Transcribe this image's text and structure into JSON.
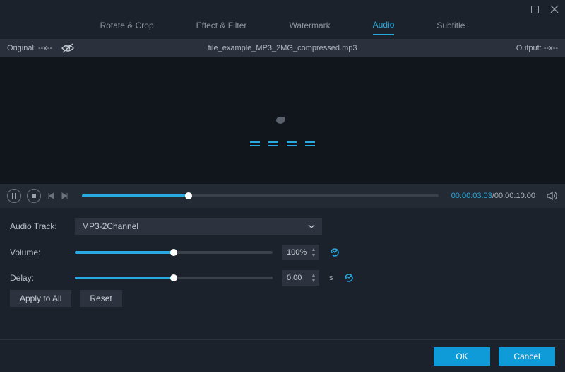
{
  "tabs": {
    "rotate": "Rotate & Crop",
    "effect": "Effect & Filter",
    "watermark": "Watermark",
    "audio": "Audio",
    "subtitle": "Subtitle"
  },
  "infobar": {
    "original_label": "Original: --x--",
    "filename": "file_example_MP3_2MG_compressed.mp3",
    "output_label": "Output: --x--"
  },
  "transport": {
    "current_time": "00:00:03.03",
    "total_time": "00:00:10.00",
    "progress_percent": 30
  },
  "audio": {
    "track_label": "Audio Track:",
    "track_value": "MP3-2Channel",
    "volume_label": "Volume:",
    "volume_value": "100%",
    "volume_slider_percent": 50,
    "delay_label": "Delay:",
    "delay_value": "0.00",
    "delay_unit": "s",
    "delay_slider_percent": 50
  },
  "buttons": {
    "apply_all": "Apply to All",
    "reset": "Reset",
    "ok": "OK",
    "cancel": "Cancel"
  }
}
